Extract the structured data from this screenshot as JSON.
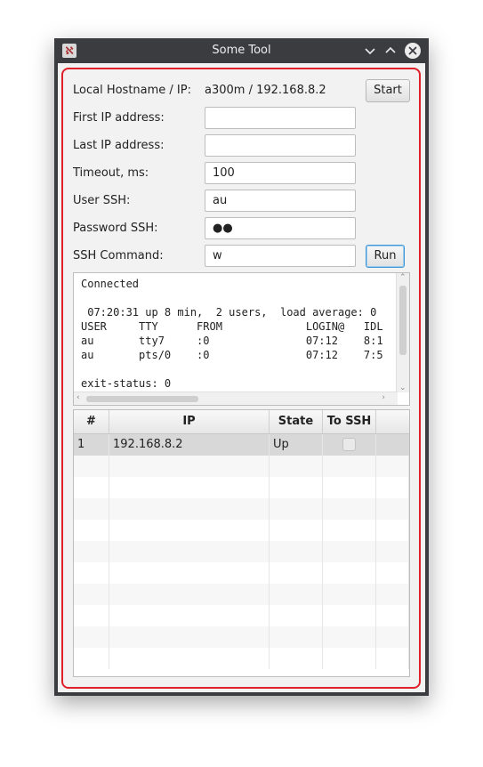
{
  "window": {
    "title": "Some Tool",
    "icon": "app-logo-icon",
    "controls": [
      "minimize-icon",
      "maximize-icon",
      "close-icon"
    ]
  },
  "form": {
    "hostname_label": "Local Hostname / IP:",
    "hostname_value": "a300m / 192.168.8.2",
    "start_label": "Start",
    "first_ip_label": "First IP address:",
    "first_ip_value": "",
    "last_ip_label": "Last IP address:",
    "last_ip_value": "",
    "timeout_label": "Timeout, ms:",
    "timeout_value": "100",
    "user_label": "User SSH:",
    "user_value": "au",
    "password_label": "Password SSH:",
    "password_value": "●●",
    "command_label": "SSH Command:",
    "command_value": "w",
    "run_label": "Run"
  },
  "console": {
    "text": "Connected\n\n 07:20:31 up 8 min,  2 users,  load average: 0\nUSER     TTY      FROM             LOGIN@   IDL\nau       tty7     :0               07:12    8:1\nau       pts/0    :0               07:12    7:5\n\nexit-status: 0"
  },
  "table": {
    "columns": [
      "#",
      "IP",
      "State",
      "To SSH"
    ],
    "rows": [
      {
        "num": "1",
        "ip": "192.168.8.2",
        "state": "Up",
        "to_ssh": false
      }
    ]
  },
  "colors": {
    "focus_frame": "#e0202a",
    "titlebar": "#3a3c40",
    "run_focus": "#3d98d8"
  }
}
